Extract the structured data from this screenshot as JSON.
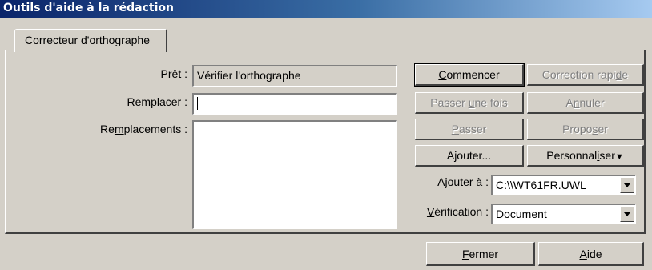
{
  "window": {
    "title": "Outils d'aide à la rédaction"
  },
  "tabs": [
    {
      "label": "Correcteur d'orthographe"
    }
  ],
  "fields": {
    "pret_label": "Prêt :",
    "pret_value": "Vérifier l'orthographe",
    "remplacer_label_pre": "Rem",
    "remplacer_label_ul": "p",
    "remplacer_label_post": "lacer :",
    "remplacer_value": "",
    "remplacements_label_pre": "Re",
    "remplacements_label_ul": "m",
    "remplacements_label_post": "placements :"
  },
  "buttons": {
    "commencer": {
      "ul": "C",
      "rest": "ommencer"
    },
    "correction_rapide": {
      "pre": "Correction rapi",
      "ul": "d",
      "post": "e"
    },
    "passer_une_fois": {
      "pre": "Passer ",
      "ul": "u",
      "post": "ne fois"
    },
    "annuler": {
      "pre": "A",
      "ul": "n",
      "post": "nuler"
    },
    "passer": {
      "ul": "P",
      "rest": "asser"
    },
    "proposer": {
      "pre": "Propo",
      "ul": "s",
      "post": "er"
    },
    "ajouter": "Ajouter...",
    "personnaliser": {
      "pre": "Personnal",
      "ul": "i",
      "post": "ser",
      "arrow": "▼"
    },
    "fermer": {
      "ul": "F",
      "rest": "ermer"
    },
    "aide": {
      "ul": "A",
      "rest": "ide"
    }
  },
  "combos": {
    "ajouter_a": {
      "label_pre": "A",
      "label_ul": "j",
      "label_post": "outer à :",
      "value": "C:\\\\WT61FR.UWL"
    },
    "verification": {
      "label_ul": "V",
      "label_post": "érification :",
      "value": "Document"
    }
  }
}
